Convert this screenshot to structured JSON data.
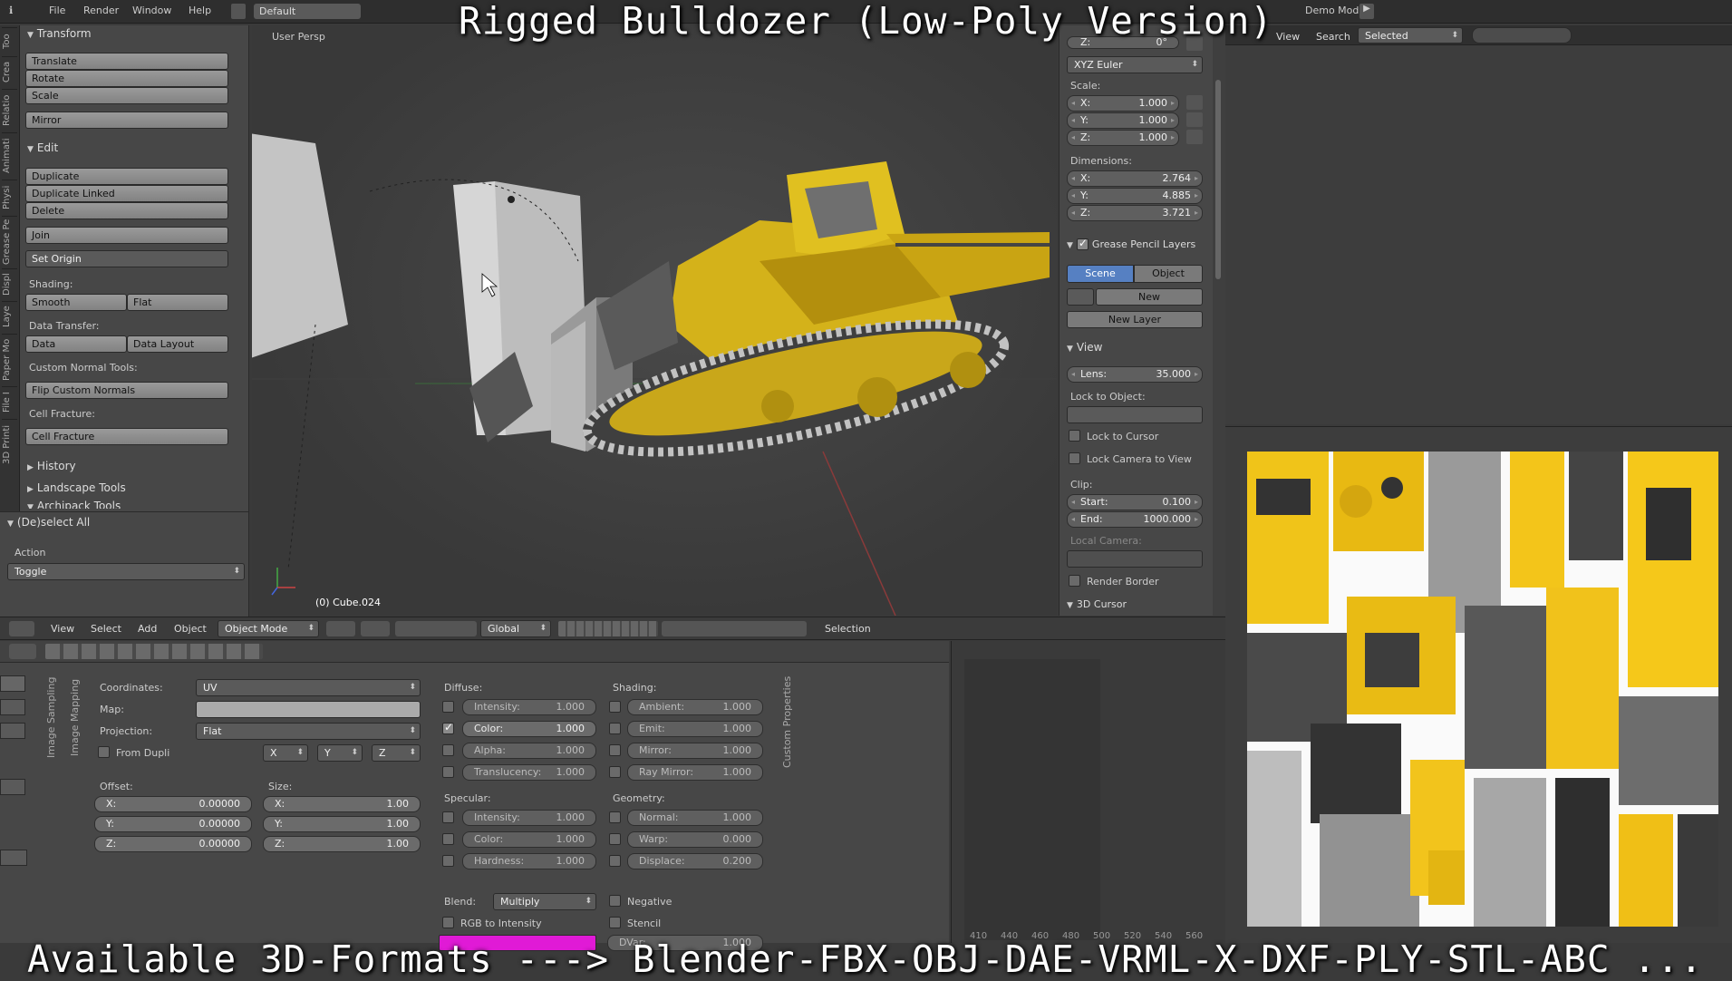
{
  "overlay": {
    "title": "Rigged Bulldozer (Low-Poly Version)",
    "formats": "Available 3D-Formats ---> Blender-FBX-OBJ-DAE-VRML-X-DXF-PLY-STL-ABC ..."
  },
  "topbar": {
    "menus": [
      "File",
      "Render",
      "Window",
      "Help"
    ],
    "layout": "Default",
    "demo": "Demo Mode:"
  },
  "vtabs": [
    "Too",
    "Crea",
    "Relatio",
    "Animati",
    "Physi",
    "Grease Pe",
    "Displ",
    "Laye",
    "Paper Mo",
    "File I",
    "3D Printi"
  ],
  "toolshelf": {
    "transform": "Transform",
    "translate": "Translate",
    "rotate": "Rotate",
    "scale": "Scale",
    "mirror": "Mirror",
    "edit": "Edit",
    "duplicate": "Duplicate",
    "duplicate_linked": "Duplicate Linked",
    "delete": "Delete",
    "join": "Join",
    "set_origin": "Set Origin",
    "shading": "Shading:",
    "smooth": "Smooth",
    "flat": "Flat",
    "data_transfer": "Data Transfer:",
    "data": "Data",
    "data_layout": "Data Layout",
    "custom_normal": "Custom Normal Tools:",
    "flip_normals": "Flip Custom Normals",
    "cell_fracture_lbl": "Cell Fracture:",
    "cell_fracture": "Cell Fracture",
    "history": "History",
    "landscape": "Landscape Tools",
    "archipack": "Archipack Tools",
    "deselect": "(De)select All",
    "action": "Action",
    "toggle": "Toggle"
  },
  "viewport": {
    "label": "User Persp",
    "object": "(0) Cube.024"
  },
  "nprop": {
    "z_rot": "0°",
    "rot_mode": "XYZ Euler",
    "scale": "Scale:",
    "sx": "1.000",
    "sy": "1.000",
    "sz": "1.000",
    "dimensions": "Dimensions:",
    "dx": "2.764",
    "dy": "4.885",
    "dz": "3.721",
    "grease": "Grease Pencil Layers",
    "scene": "Scene",
    "object": "Object",
    "new": "New",
    "new_layer": "New Layer",
    "view": "View",
    "lens_k": "Lens:",
    "lens_v": "35.000",
    "lock_obj": "Lock to Object:",
    "lock_cursor": "Lock to Cursor",
    "lock_camera": "Lock Camera to View",
    "clip": "Clip:",
    "start_k": "Start:",
    "start_v": "0.100",
    "end_k": "End:",
    "end_v": "1000.000",
    "local_camera": "Local Camera:",
    "render_border": "Render Border",
    "cursor3d": "3D Cursor"
  },
  "right": {
    "view": "View",
    "search": "Search",
    "selected": "Selected"
  },
  "header": {
    "view": "View",
    "select": "Select",
    "add": "Add",
    "object": "Object",
    "mode": "Object Mode",
    "orient": "Global",
    "selection": "Selection"
  },
  "props": {
    "tabs": [
      "Image Sampling",
      "Image Mapping"
    ],
    "custom": "Custom Properties",
    "coordinates": "Coordinates:",
    "coord_val": "UV",
    "map": "Map:",
    "projection": "Projection:",
    "proj_val": "Flat",
    "from_dupli": "From Dupli",
    "axes": [
      "X",
      "Y",
      "Z"
    ],
    "offset": "Offset:",
    "size": "Size:",
    "ox": "0.00000",
    "oy": "0.00000",
    "oz": "0.00000",
    "szx": "1.00",
    "szy": "1.00",
    "szz": "1.00",
    "diffuse": "Diffuse:",
    "d_int": "Intensity:",
    "d_int_v": "1.000",
    "d_col": "Color:",
    "d_col_v": "1.000",
    "d_alpha": "Alpha:",
    "d_alpha_v": "1.000",
    "d_trans": "Translucency:",
    "d_trans_v": "1.000",
    "specular": "Specular:",
    "s_int": "Intensity:",
    "s_int_v": "1.000",
    "s_col": "Color:",
    "s_col_v": "1.000",
    "s_hard": "Hardness:",
    "s_hard_v": "1.000",
    "shading": "Shading:",
    "amb": "Ambient:",
    "amb_v": "1.000",
    "emit": "Emit:",
    "emit_v": "1.000",
    "mirror": "Mirror:",
    "mirror_v": "1.000",
    "ray": "Ray Mirror:",
    "ray_v": "1.000",
    "geometry": "Geometry:",
    "normal": "Normal:",
    "normal_v": "1.000",
    "warp": "Warp:",
    "warp_v": "0.000",
    "displace": "Displace:",
    "displace_v": "0.200",
    "blend": "Blend:",
    "blend_val": "Multiply",
    "negative": "Negative",
    "rgb": "RGB to Intensity",
    "stencil": "Stencil",
    "dvar": "DVar:",
    "dvar_v": "1.000"
  },
  "timeline": {
    "ticks": [
      "410",
      "440",
      "460",
      "480",
      "500",
      "520",
      "540",
      "560"
    ]
  }
}
